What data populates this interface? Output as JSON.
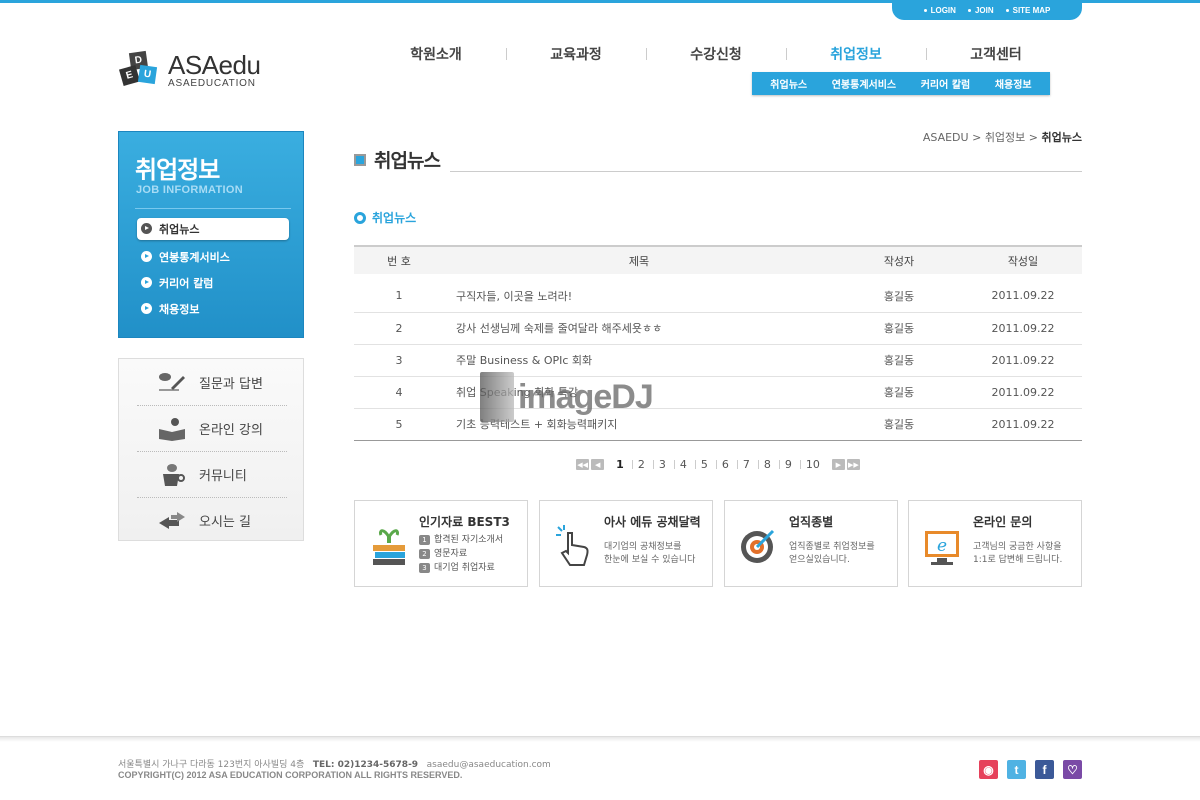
{
  "util_nav": [
    "LOGIN",
    "JOIN",
    "SITE MAP"
  ],
  "logo": {
    "cubes": [
      "D",
      "E",
      "U"
    ],
    "main": "ASAedu",
    "sub": "ASAEDUCATION"
  },
  "gnb": [
    {
      "label": "학원소개",
      "active": false
    },
    {
      "label": "교육과정",
      "active": false
    },
    {
      "label": "수강신청",
      "active": false
    },
    {
      "label": "취업정보",
      "active": true
    },
    {
      "label": "고객센터",
      "active": false
    }
  ],
  "sub_gnb": [
    "취업뉴스",
    "연봉통계서비스",
    "커리어 칼럼",
    "채용정보"
  ],
  "lnb": {
    "title": "취업정보",
    "subtitle": "JOB INFORMATION",
    "items": [
      "취업뉴스",
      "연봉통계서비스",
      "커리어 칼럼",
      "채용정보"
    ]
  },
  "quick_menu": [
    "질문과 답변",
    "온라인 강의",
    "커뮤니티",
    "오시는 길"
  ],
  "breadcrumb": {
    "home": "ASAEDU",
    "sep": " > ",
    "level1": "취업정보",
    "current": "취업뉴스"
  },
  "page_title": "취업뉴스",
  "section_title": "취업뉴스",
  "table": {
    "headers": [
      "번 호",
      "제목",
      "작성자",
      "작성일"
    ],
    "rows": [
      [
        "1",
        "구직자들, 이곳을 노려라!",
        "홍길동",
        "2011.09.22"
      ],
      [
        "2",
        "강사 선생님께 숙제를 줄여달라 해주세욧ㅎㅎ",
        "홍길동",
        "2011.09.22"
      ],
      [
        "3",
        "주말 Business & OPIc 회화",
        "홍길동",
        "2011.09.22"
      ],
      [
        "4",
        "취업 Speaking 회화 특강",
        "홍길동",
        "2011.09.22"
      ],
      [
        "5",
        "기초 능력테스트 + 회화능력패키지",
        "홍길동",
        "2011.09.22"
      ]
    ]
  },
  "pagination": {
    "pages": [
      "1",
      "2",
      "3",
      "4",
      "5",
      "6",
      "7",
      "8",
      "9",
      "10"
    ],
    "current": "1"
  },
  "banners": [
    {
      "title": "인기자료 BEST3",
      "list": [
        "합격된 자기소개서",
        "영문자료",
        "대기업 취업자료"
      ]
    },
    {
      "title": "아사 에듀 공채달력",
      "desc": [
        "대기업의 공채정보를",
        "한눈에 보실 수 있습니다"
      ]
    },
    {
      "title": "업직종별",
      "desc": [
        "업직종별로 취업정보를",
        "얻으실있습니다."
      ]
    },
    {
      "title": "온라인 문의",
      "desc": [
        "고객님의 궁금한 사항을",
        "1:1로 답변해 드립니다."
      ]
    }
  ],
  "watermark": "imageDJ",
  "footer": {
    "address": "서울특별시 가나구 다라동 123번지 아사빌딩 4층",
    "tel": "TEL: 02)1234-5678-9",
    "email": "asaedu@asaeducation.com",
    "copyright": "COPYRIGHT(C) 2012 ASA EDUCATION CORPORATION ALL RIGHTS RESERVED."
  },
  "sns": [
    {
      "name": "cyworld-icon",
      "glyph": "◉",
      "color": "#e6415b"
    },
    {
      "name": "twitter-icon",
      "glyph": "t",
      "color": "#4fb2e3"
    },
    {
      "name": "facebook-icon",
      "glyph": "f",
      "color": "#3b5998"
    },
    {
      "name": "me2day-icon",
      "glyph": "♡",
      "color": "#7a4aa6"
    }
  ],
  "colors": {
    "accent": "#2aa4dc"
  }
}
